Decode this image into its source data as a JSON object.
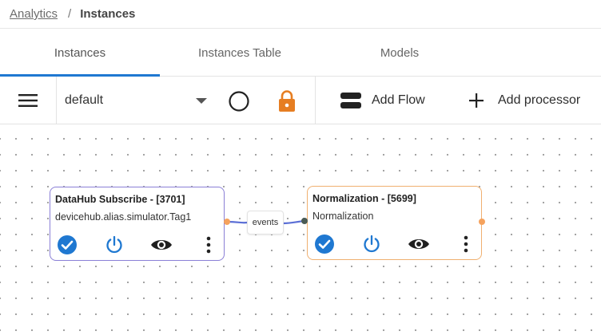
{
  "breadcrumb": {
    "parent": "Analytics",
    "separator": "/",
    "current": "Instances"
  },
  "tabs": [
    {
      "label": "Instances",
      "active": true
    },
    {
      "label": "Instances Table",
      "active": false
    },
    {
      "label": "Models",
      "active": false
    }
  ],
  "toolbar": {
    "menu_icon": "hamburger-menu-icon",
    "flow_select": {
      "value": "default"
    },
    "status_icon": "circle-outline-icon",
    "lock_icon": "lock-icon",
    "add_flow_label": "Add Flow",
    "add_processor_label": "Add processor"
  },
  "nodes": [
    {
      "title": "DataHub Subscribe - [3701]",
      "subtitle": "devicehub.alias.simulator.Tag1",
      "border_color": "#8a7fd6"
    },
    {
      "title": "Normalization - [5699]",
      "subtitle": "Normalization",
      "border_color": "#f0b070"
    }
  ],
  "edge": {
    "label": "events",
    "color": "#5b6fd6"
  },
  "colors": {
    "accent": "#1f78d1",
    "lock": "#e67e22",
    "output_handle": "#f5a25d",
    "input_handle": "#4a5b55"
  }
}
